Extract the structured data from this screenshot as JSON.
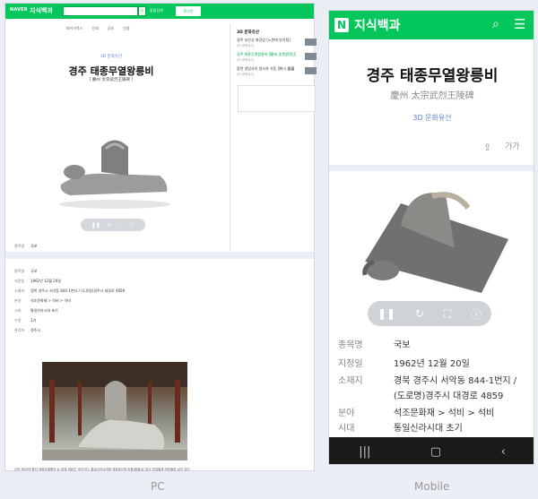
{
  "pc": {
    "logo": "NAVER",
    "brand": "지식백과",
    "search_all": "통합검색",
    "login": "로그인",
    "tools": [
      "파이어폭스",
      "인쇄",
      "공유",
      "인용"
    ],
    "label_3d": "3D 문화유산",
    "title": "경주 태종무열왕릉비",
    "hanja": "[ 慶州 太宗武烈王陵碑 ]",
    "sidebar_title": "3D 문화유산",
    "sidebar_items": [
      {
        "text": "경주 부산성 화강암 [노천에 방치됨]",
        "sub": "3D 문화유산"
      },
      {
        "text": "경주 태종무열왕릉비 [慶州 太宗武烈王",
        "sub": "3D 문화유산"
      },
      {
        "text": "합천 영암사지 쌍사자 석등 [陜川 靈巖",
        "sub": "3D 문화유산"
      }
    ],
    "field_top": {
      "key": "종목명",
      "value": "국보"
    },
    "rows": [
      {
        "k": "종목명",
        "v": "국보"
      },
      {
        "k": "지정일",
        "v": "1962년 12월 20일"
      },
      {
        "k": "소재지",
        "v": "경북 경주시 서악동 844-1번지 / (도로명)경주시 대경로 4859"
      },
      {
        "k": "분야",
        "v": "석조문화재 > 석비 > 석비"
      },
      {
        "k": "시대",
        "v": "통일신라시대 초기"
      },
      {
        "k": "수량",
        "v": "1기"
      },
      {
        "k": "관리자",
        "v": "경주시"
      }
    ],
    "caption": "신라 제29대 왕인 태종무열왕의 능 앞에 세워진 석비이다. 통일신라시대에 세워졌으며 비몸(몸돌)은 없고 받침돌과 머릿돌만 남아 있다."
  },
  "mobile": {
    "logo_letter": "N",
    "brand": "지식백과",
    "title": "경주 태종무열왕릉비",
    "hanja": "慶州 太宗武烈王陵碑",
    "label_3d": "3D 문화유산",
    "font_btn": "가가",
    "rows": [
      {
        "k": "종목명",
        "v": "국보"
      },
      {
        "k": "지정일",
        "v": "1962년 12월 20일"
      },
      {
        "k": "소재지",
        "v": "경북 경주시 서악동 844-1번지 /"
      },
      {
        "k": "",
        "v": "(도로명)경주시 대경로 4859"
      },
      {
        "k": "분야",
        "v": "석조문화재 > 석비 > 석비"
      },
      {
        "k": "시대",
        "v": "통일신라시대 초기"
      }
    ]
  },
  "labels": {
    "pc": "PC",
    "mobile": "Mobile"
  }
}
